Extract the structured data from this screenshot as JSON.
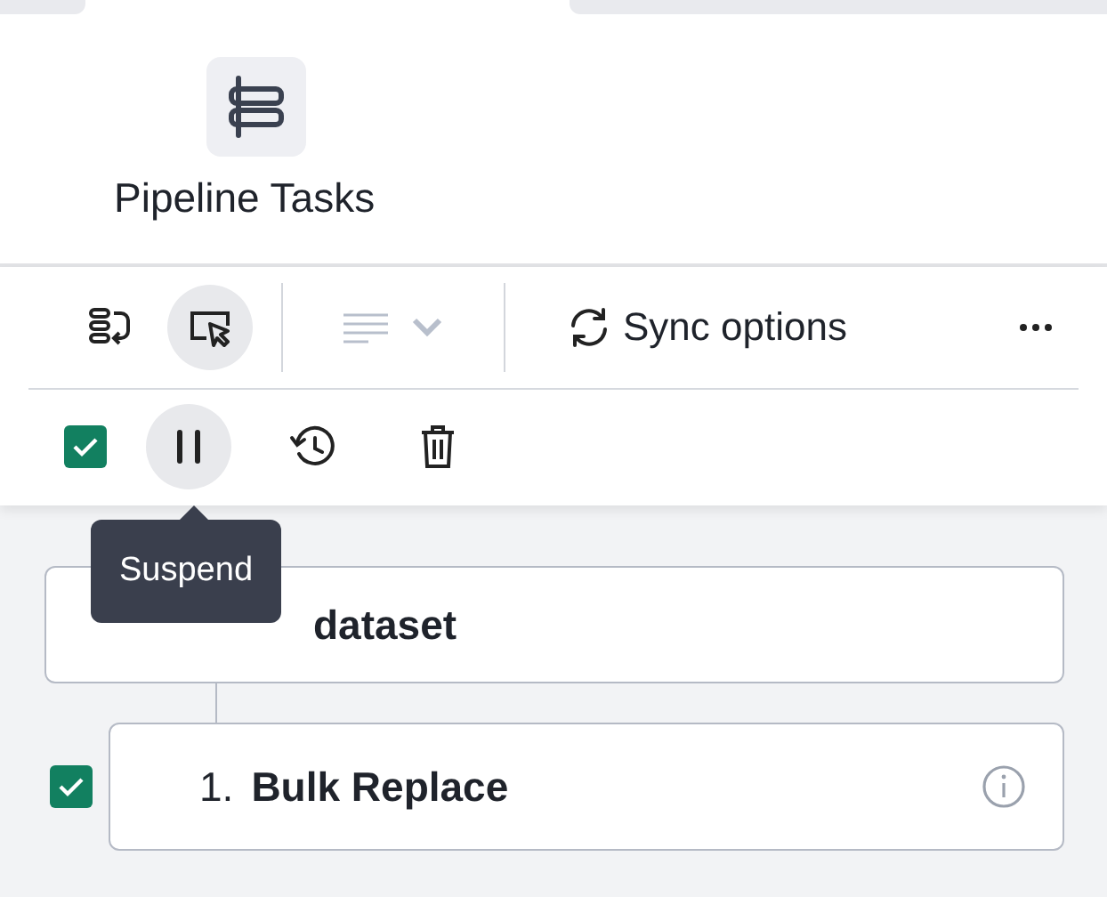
{
  "tabs": [
    {
      "kind": "left",
      "selected": false
    },
    {
      "kind": "middle",
      "selected": true
    },
    {
      "kind": "right",
      "selected": false
    }
  ],
  "panel": {
    "title": "Pipeline Tasks"
  },
  "toolbar": {
    "sync_label": "Sync options",
    "select_mode": {
      "selected": true
    },
    "format": {
      "disabled": true
    }
  },
  "actions": {
    "select_all": {
      "checked": true
    },
    "pause": {
      "hovered": true
    },
    "tooltip": "Suspend"
  },
  "pipeline": {
    "source": "dataset",
    "steps": [
      {
        "number": "1.",
        "name": "Bulk Replace",
        "checked": true
      }
    ]
  }
}
